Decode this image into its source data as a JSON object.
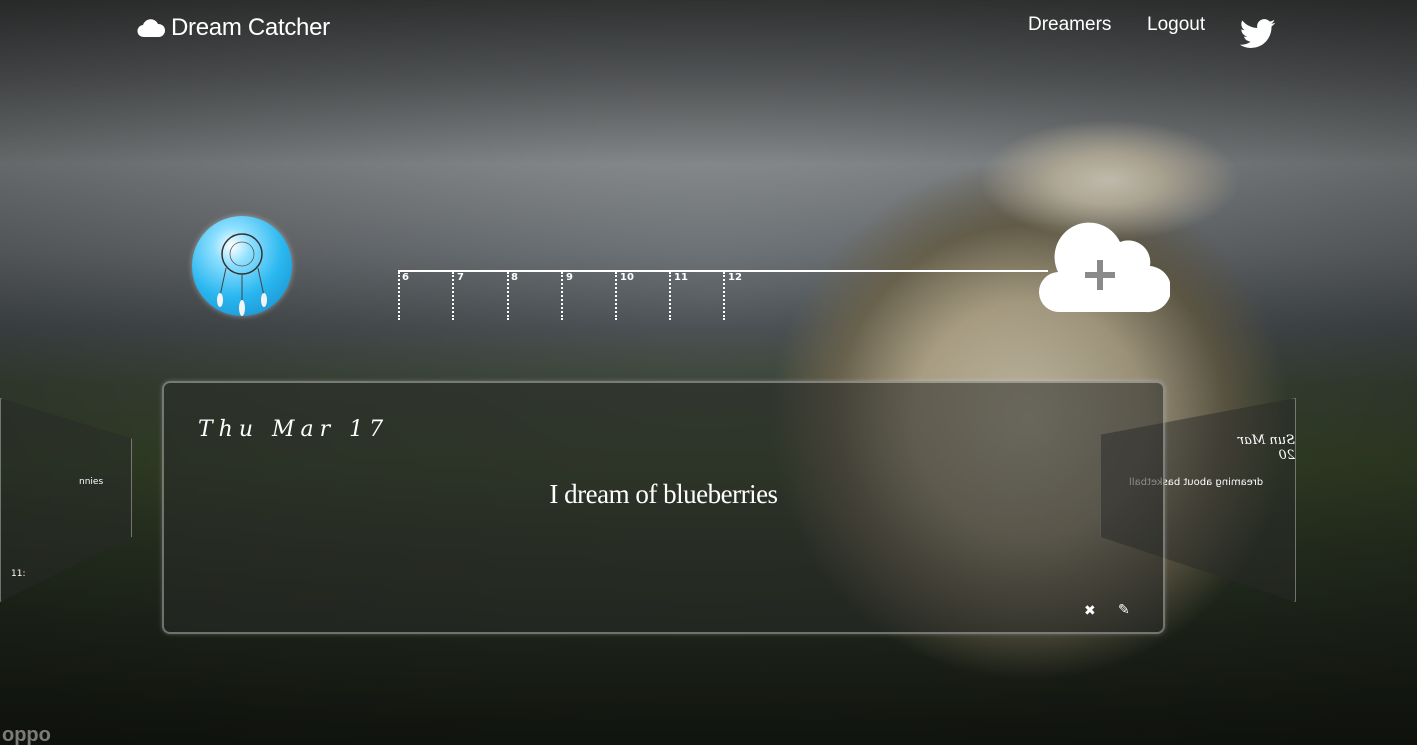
{
  "header": {
    "brand": "Dream Catcher",
    "nav": [
      {
        "label": "Dreamers"
      },
      {
        "label": "Logout"
      }
    ]
  },
  "timeline": {
    "ticks": [
      "6",
      "7",
      "8",
      "9",
      "10",
      "11",
      "12"
    ]
  },
  "current_dream": {
    "date": "Thu Mar 17",
    "text": "I dream of blueberries"
  },
  "prev_card": {
    "text": "nnies",
    "time": "11:"
  },
  "next_card": {
    "date": "Sun Mar 20",
    "text": "dreaming about basketball"
  },
  "watermark": "oppo",
  "colors": {
    "text": "#ffffff",
    "card_bg": "rgba(40,42,40,0.55)"
  },
  "icons": {
    "brand": "cloud-icon",
    "twitter": "twitter-icon",
    "add": "cloud-plus-icon",
    "delete": "close-icon",
    "edit": "pencil-icon"
  }
}
